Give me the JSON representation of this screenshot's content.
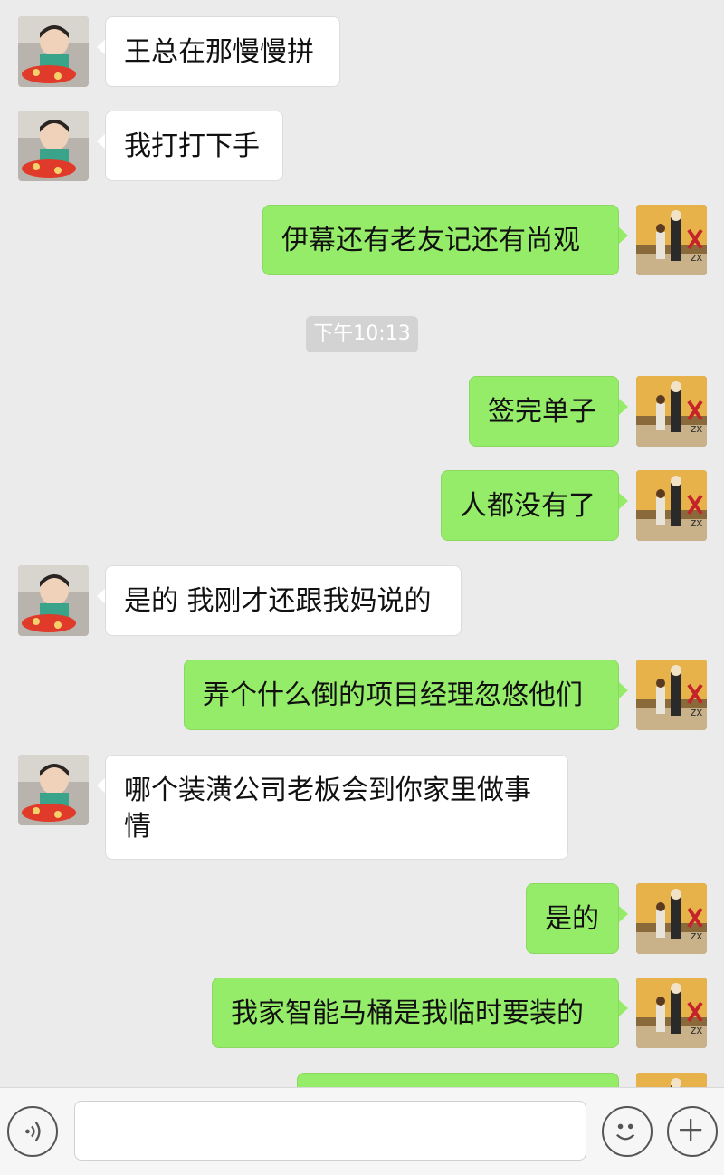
{
  "messages": [
    {
      "side": "in",
      "text": "王总在那慢慢拼"
    },
    {
      "side": "in",
      "text": "我打打下手"
    },
    {
      "side": "out",
      "text": "伊幕还有老友记还有尚观"
    },
    {
      "side": "out",
      "text": "签完单子"
    },
    {
      "side": "out",
      "text": "人都没有了"
    },
    {
      "side": "in",
      "text": "是的 我刚才还跟我妈说的"
    },
    {
      "side": "out",
      "text": "弄个什么倒的项目经理忽悠他们"
    },
    {
      "side": "in",
      "text": "哪个装潢公司老板会到你家里做事\n情"
    },
    {
      "side": "out",
      "text": "是的"
    },
    {
      "side": "out",
      "text": "我家智能马桶是我临时要装的"
    },
    {
      "side": "out",
      "text": ""
    }
  ],
  "timestamp": "下午10:13",
  "input_bar": {
    "voice_icon": "voice-icon",
    "emoji_icon": "emoji-icon",
    "plus_icon": "plus-icon",
    "input_value": ""
  },
  "colors": {
    "background": "#ebebeb",
    "outgoing_bubble": "#95ec69",
    "incoming_bubble": "#ffffff",
    "timestamp_bg": "#d3d3d3"
  }
}
